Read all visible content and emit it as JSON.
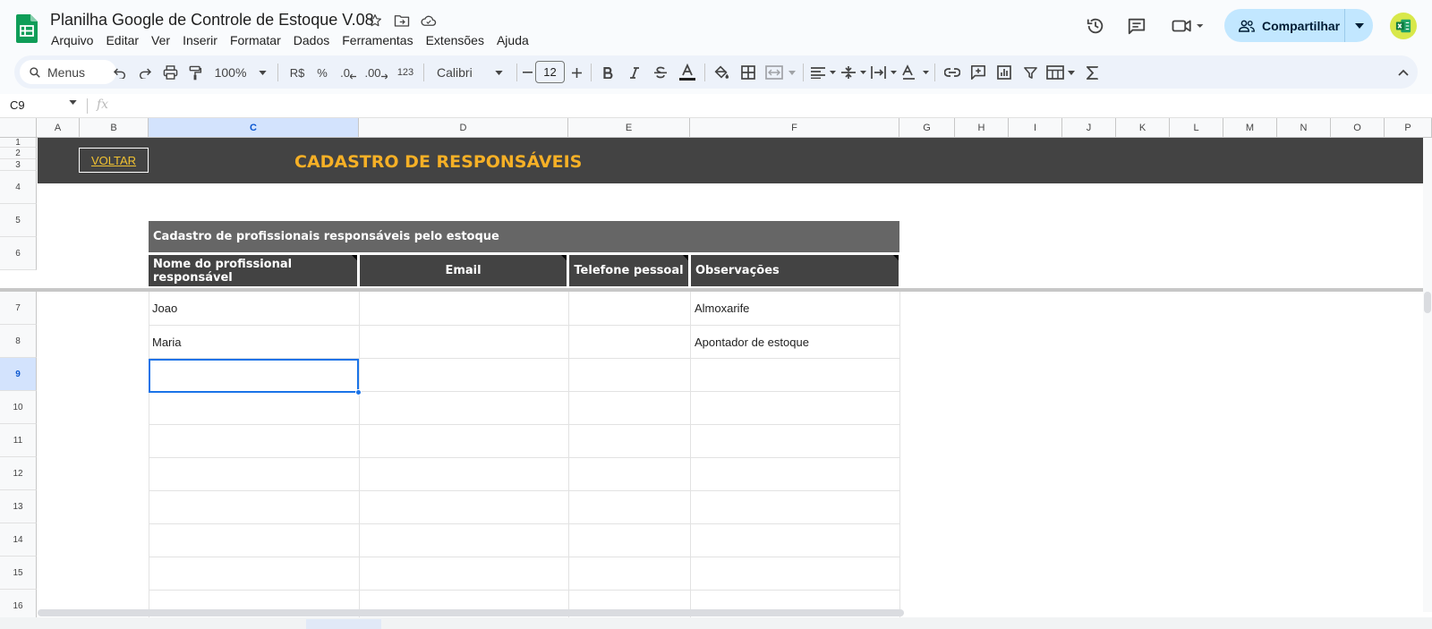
{
  "document": {
    "title": "Planilha Google de Controle de Estoque V.08"
  },
  "menu": [
    "Arquivo",
    "Editar",
    "Ver",
    "Inserir",
    "Formatar",
    "Dados",
    "Ferramentas",
    "Extensões",
    "Ajuda"
  ],
  "header": {
    "share_label": "Compartilhar"
  },
  "toolbar": {
    "search_label": "Menus",
    "zoom": "100%",
    "currency": "R$",
    "percent": "%",
    "decimal_decrease": ".0",
    "decimal_increase": ".00",
    "number_format": "123",
    "font": "Calibri",
    "font_size": "12"
  },
  "formula_bar": {
    "cell_ref": "C9",
    "fx": "fx"
  },
  "columns": [
    "A",
    "B",
    "C",
    "D",
    "E",
    "F",
    "G",
    "H",
    "I",
    "J",
    "K",
    "L",
    "M",
    "N",
    "O",
    "P"
  ],
  "rows": [
    "1",
    "2",
    "3",
    "4",
    "5",
    "6",
    "7",
    "8",
    "9",
    "10",
    "11",
    "12",
    "13",
    "14",
    "15",
    "16"
  ],
  "selected": {
    "column": "C",
    "row": "9"
  },
  "sheet": {
    "back_button": "VOLTAR",
    "banner_title": "CADASTRO DE RESPONSÁVEIS",
    "subtitle": "Cadastro de profissionais responsáveis pelo estoque",
    "headers": [
      "Nome do profissional responsável",
      "Email",
      "Telefone pessoal",
      "Observações"
    ],
    "records": [
      {
        "name": "Joao",
        "email": "",
        "phone": "",
        "notes": "Almoxarife"
      },
      {
        "name": "Maria",
        "email": "",
        "phone": "",
        "notes": "Apontador de estoque"
      }
    ]
  },
  "colors": {
    "banner": "#434343",
    "banner_title": "#f6b026",
    "subheader": "#666666",
    "selection": "#1a73e8",
    "share_button": "#c2e7ff"
  }
}
